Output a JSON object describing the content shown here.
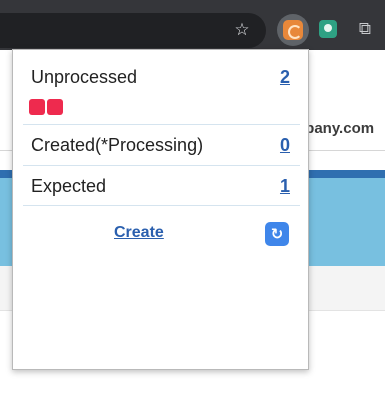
{
  "toolbar": {
    "star_icon": "star-icon",
    "extensions": [
      "active-extension-icon",
      "green-extension-icon",
      "puzzle-extensions-icon"
    ]
  },
  "page": {
    "partial_text": "npany.com"
  },
  "popup": {
    "rows": [
      {
        "label": "Unprocessed",
        "count": "2",
        "chips": 2,
        "chip_color": "#ee2a4e"
      },
      {
        "label": "Created(*Processing)",
        "count": "0"
      },
      {
        "label": "Expected",
        "count": "1"
      }
    ],
    "create_label": "Create",
    "refresh_icon": "refresh-icon",
    "refresh_glyph": "↻",
    "link_color": "#2a5fae"
  }
}
